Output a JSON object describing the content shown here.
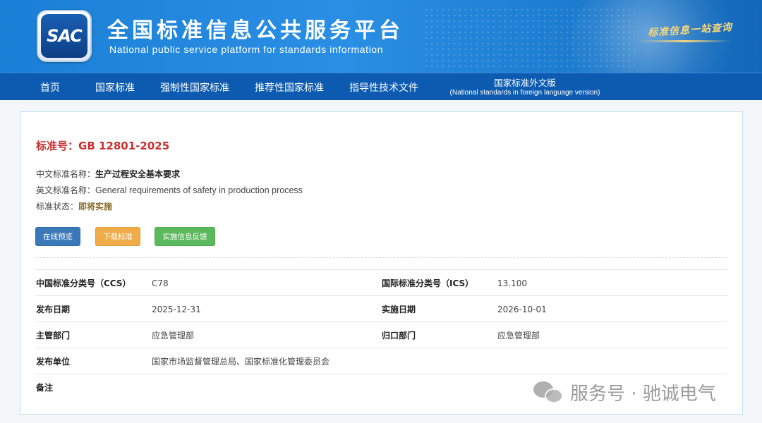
{
  "header": {
    "logo_text": "SAC",
    "title": "全国标准信息公共服务平台",
    "subtitle": "National public service platform  for standards information",
    "slogan": "标准信息一站查询"
  },
  "nav": {
    "items": [
      {
        "label": "首页"
      },
      {
        "label": "国家标准"
      },
      {
        "label": "强制性国家标准"
      },
      {
        "label": "推荐性国家标准"
      },
      {
        "label": "指导性技术文件"
      }
    ],
    "foreign": {
      "label": "国家标准外文版",
      "sublabel": "(National standards in foreign language version)"
    }
  },
  "standard": {
    "number_label": "标准号：",
    "number": "GB 12801-2025",
    "cn_name_label": "中文标准名称：",
    "cn_name": "生产过程安全基本要求",
    "en_name_label": "英文标准名称：",
    "en_name": "General requirements of safety in production process",
    "status_label": "标准状态：",
    "status": "即将实施"
  },
  "actions": {
    "preview": "在线预览",
    "download": "下载标准",
    "feedback": "实施信息反馈"
  },
  "details": {
    "ccs_label": "中国标准分类号（CCS）",
    "ccs": "C78",
    "ics_label": "国际标准分类号（ICS）",
    "ics": "13.100",
    "publish_date_label": "发布日期",
    "publish_date": "2025-12-31",
    "implement_date_label": "实施日期",
    "implement_date": "2026-10-01",
    "competent_dept_label": "主管部门",
    "competent_dept": "应急管理部",
    "responsible_dept_label": "归口部门",
    "responsible_dept": "应急管理部",
    "issuer_label": "发布单位",
    "issuer": "国家市场监督管理总局、国家标准化管理委员会",
    "remarks_label": "备注",
    "remarks": ""
  },
  "watermark": {
    "text": "服务号 · 驰诚电气"
  }
}
